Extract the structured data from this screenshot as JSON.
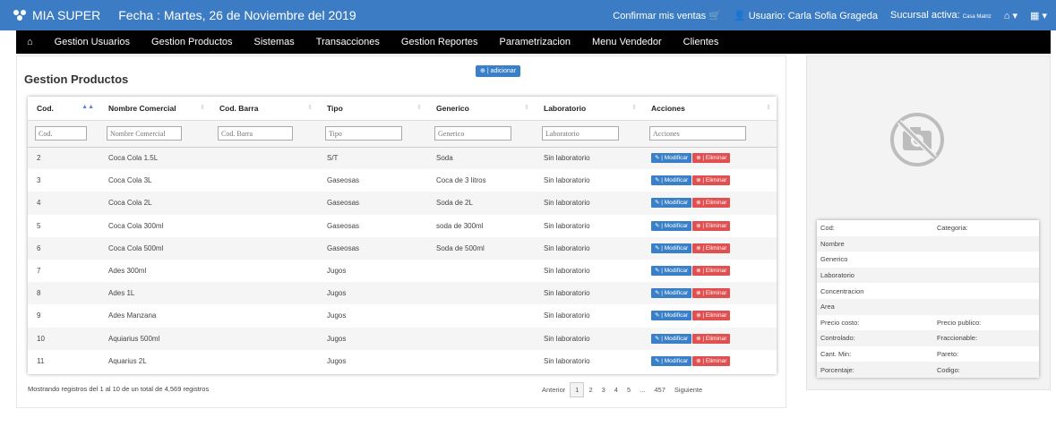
{
  "header": {
    "brand": "MIA SUPER",
    "fecha": "Fecha : Martes, 26 de Noviembre del 2019",
    "confirmar": "Confirmar mis ventas",
    "usuario": "Usuario: Carla Sofia Grageda",
    "sucursal_label": "Sucursal activa:",
    "sucursal_value": "Casa Matriz"
  },
  "nav": {
    "items": [
      "Gestion Usuarios",
      "Gestion Productos",
      "Sistemas",
      "Transacciones",
      "Gestion Reportes",
      "Parametrizacion",
      "Menu Vendedor",
      "Clientes"
    ]
  },
  "main": {
    "title": "Gestion Productos",
    "add_label": "| adicionar"
  },
  "table": {
    "headers": [
      "Cod.",
      "Nombre Comercial",
      "Cod. Barra",
      "Tipo",
      "Generico",
      "Laboratorio",
      "Acciones"
    ],
    "filters": [
      "Cod.",
      "Nombre Comercial",
      "Cod. Barra",
      "Tipo",
      "Generico",
      "Laboratorio",
      "Acciones"
    ],
    "rows": [
      {
        "cod": "2",
        "nombre": "Coca Cola 1.5L",
        "barra": "",
        "tipo": "S/T",
        "generico": "Soda",
        "lab": "Sin laboratorio"
      },
      {
        "cod": "3",
        "nombre": "Coca Cola 3L",
        "barra": "",
        "tipo": "Gaseosas",
        "generico": "Coca de 3 litros",
        "lab": "Sin laboratorio"
      },
      {
        "cod": "4",
        "nombre": "Coca Cola 2L",
        "barra": "",
        "tipo": "Gaseosas",
        "generico": "Soda de 2L",
        "lab": "Sin laboratorio"
      },
      {
        "cod": "5",
        "nombre": "Coca Cola 300ml",
        "barra": "",
        "tipo": "Gaseosas",
        "generico": "soda de 300ml",
        "lab": "Sin laboratorio"
      },
      {
        "cod": "6",
        "nombre": "Coca Cola 500ml",
        "barra": "",
        "tipo": "Gaseosas",
        "generico": "Soda de 500ml",
        "lab": "Sin laboratorio"
      },
      {
        "cod": "7",
        "nombre": "Ades 300ml",
        "barra": "",
        "tipo": "Jugos",
        "generico": "",
        "lab": "Sin laboratorio"
      },
      {
        "cod": "8",
        "nombre": "Ades 1L",
        "barra": "",
        "tipo": "Jugos",
        "generico": "",
        "lab": "Sin laboratorio"
      },
      {
        "cod": "9",
        "nombre": "Ades Manzana",
        "barra": "",
        "tipo": "Jugos",
        "generico": "",
        "lab": "Sin laboratorio"
      },
      {
        "cod": "10",
        "nombre": "Aquiarius 500ml",
        "barra": "",
        "tipo": "Jugos",
        "generico": "",
        "lab": "Sin laboratorio"
      },
      {
        "cod": "11",
        "nombre": "Aquarius 2L",
        "barra": "",
        "tipo": "Jugos",
        "generico": "",
        "lab": "Sin laboratorio"
      }
    ],
    "btn_modificar": "| Modificar",
    "btn_eliminar": "| Eliminar",
    "footer_info": "Mostrando registros del 1 al 10 de un total de 4,569 registros"
  },
  "pager": {
    "prev": "Anterior",
    "pages": [
      "1",
      "2",
      "3",
      "4",
      "5",
      "...",
      "457"
    ],
    "next": "Siguiente",
    "active": "1"
  },
  "details": {
    "rows": [
      [
        "Cod:",
        "Categoria:"
      ],
      [
        "Nombre",
        ""
      ],
      [
        "Generico",
        ""
      ],
      [
        "Laboratorio",
        ""
      ],
      [
        "Concentracion",
        ""
      ],
      [
        "Area",
        ""
      ],
      [
        "Precio costo:",
        "Precio publico:"
      ],
      [
        "Controlado:",
        "Fraccionable:"
      ],
      [
        "Cant. Min:",
        "Pareto:"
      ],
      [
        "Porcentaje:",
        "Codigo:"
      ]
    ]
  },
  "colors": {
    "topbar": "#3c7cc4",
    "navbar": "#000000",
    "btn_modificar": "#3a80c8",
    "btn_eliminar": "#e05050"
  }
}
